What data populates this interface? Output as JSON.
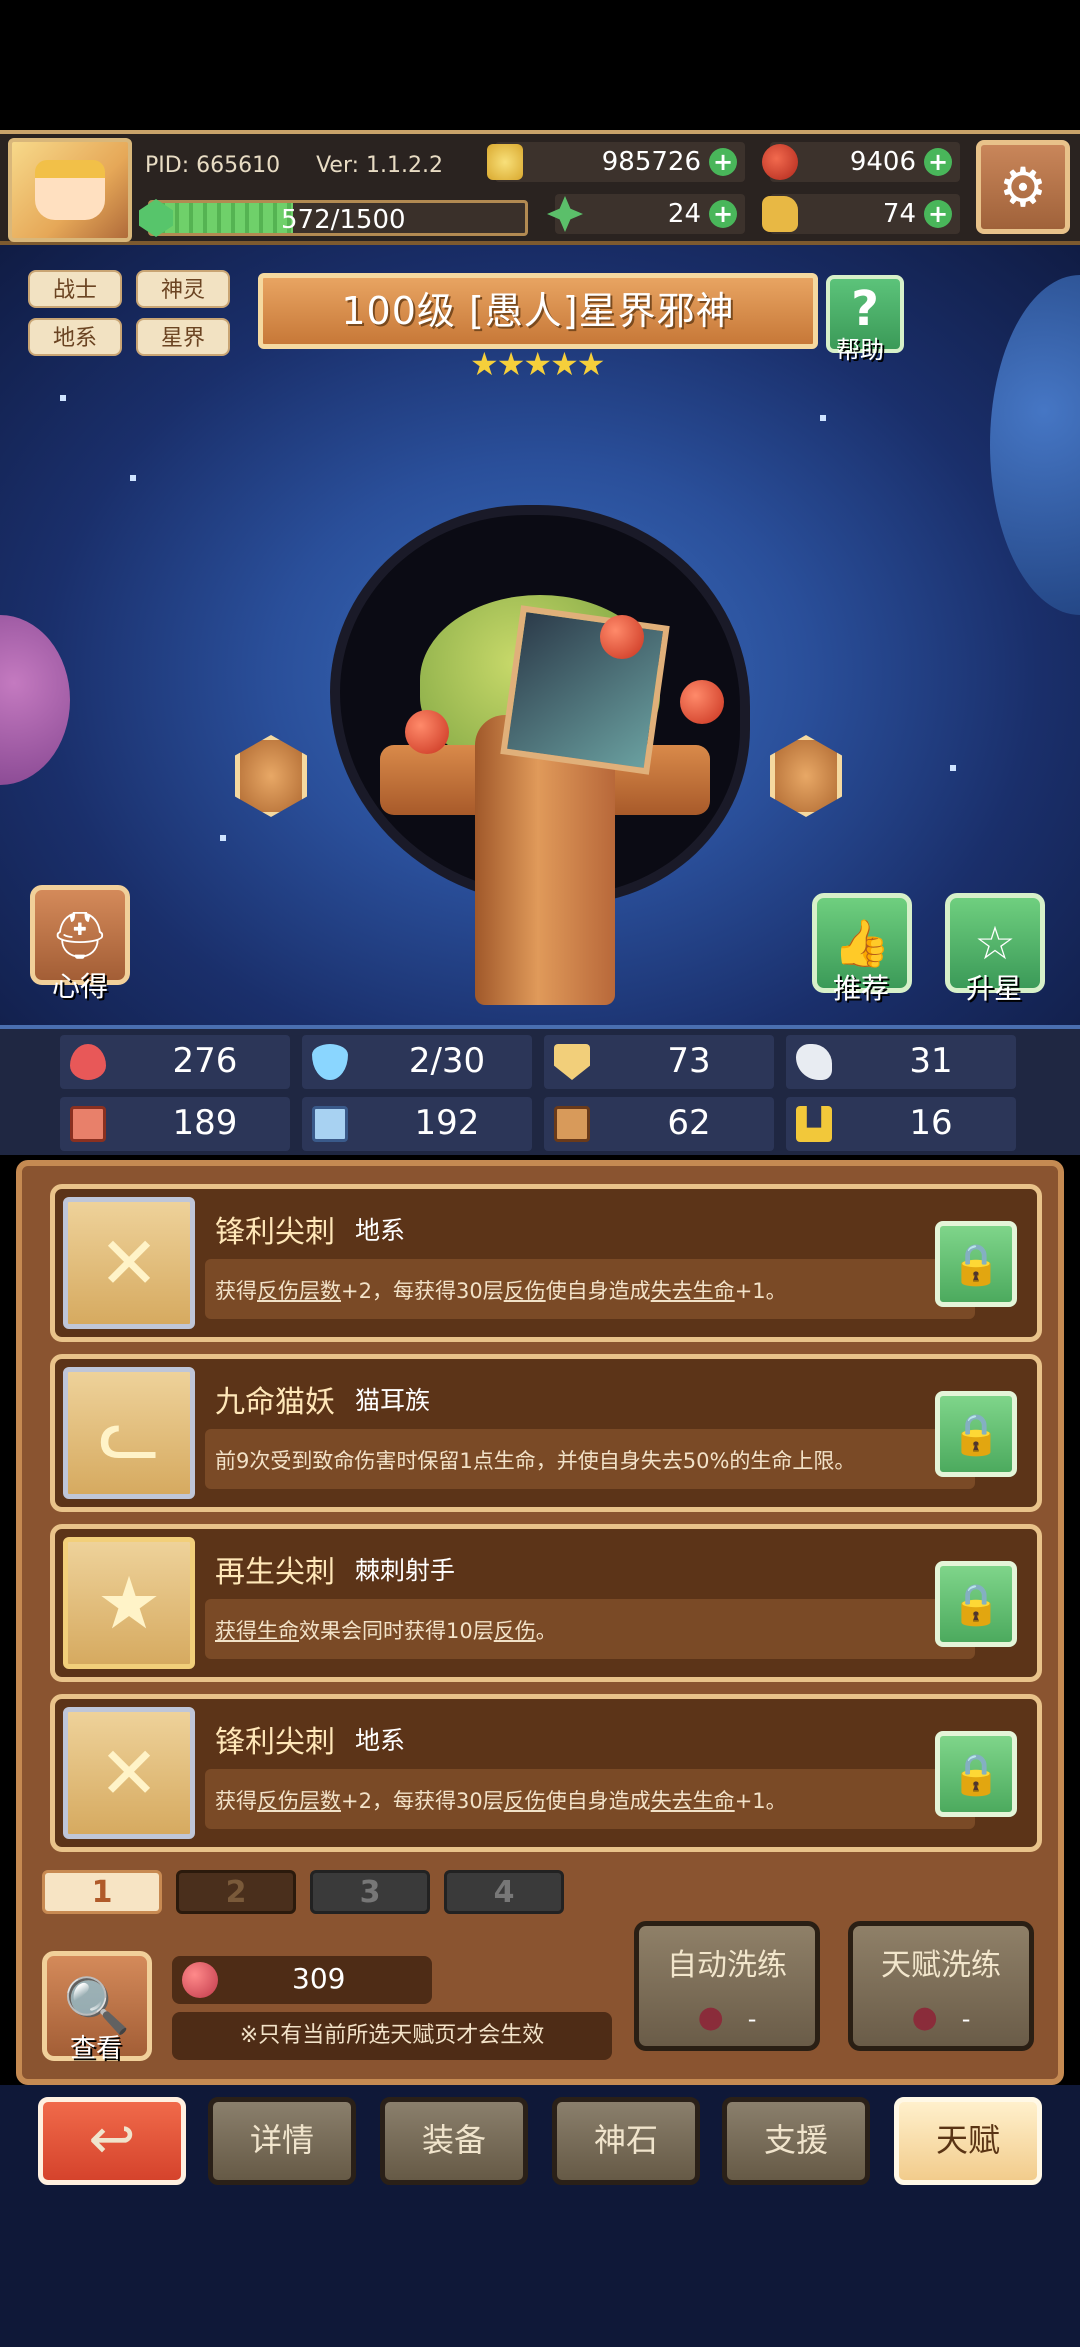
{
  "topbar": {
    "pid": "PID: 665610",
    "version": "Ver: 1.1.2.2",
    "xp": "572/1500",
    "xp_fraction": 0.381,
    "coins": "985726",
    "apples": "9406",
    "clovers": "24",
    "bags": "74"
  },
  "tags": [
    "战士",
    "神灵",
    "地系",
    "星界"
  ],
  "title": "100级 [愚人]星界邪神",
  "stars": "★★★★★",
  "help_label": "帮助",
  "side_buttons": {
    "xinde": "心得",
    "tuijian": "推荐",
    "shengxing": "升星"
  },
  "stats": {
    "hp": "276",
    "mana": "2/30",
    "defense": "73",
    "speed": "31",
    "attack": "189",
    "magic": "192",
    "stairs": "62",
    "horseshoe": "16"
  },
  "talents": [
    {
      "name": "锋利尖刺",
      "kind": "地系",
      "desc_parts": [
        "获得",
        "反伤层数",
        "+2，每获得30层",
        "反伤",
        "使自身造成",
        "失去生命",
        "+1。"
      ]
    },
    {
      "name": "九命猫妖",
      "kind": "猫耳族",
      "desc": "前9次受到致命伤害时保留1点生命，并使自身失去50%的生命上限。"
    },
    {
      "name": "再生尖刺",
      "kind": "棘刺射手",
      "desc_parts": [
        "获得生命",
        "效果会同时获得10层",
        "反伤",
        "。"
      ]
    },
    {
      "name": "锋利尖刺",
      "kind": "地系",
      "desc_parts": [
        "获得",
        "反伤层数",
        "+2，每获得30层",
        "反伤",
        "使自身造成",
        "失去生命",
        "+1。"
      ]
    }
  ],
  "pages": [
    "1",
    "2",
    "3",
    "4"
  ],
  "look_label": "查看",
  "fruit_count": "309",
  "notice": "※只有当前所选天赋页才会生效",
  "auto_refine": {
    "label": "自动洗练",
    "cost": "-"
  },
  "talent_refine": {
    "label": "天赋洗练",
    "cost": "-"
  },
  "nav": {
    "detail": "详情",
    "equip": "装备",
    "godstone": "神石",
    "support": "支援",
    "talent": "天赋"
  },
  "colors": {
    "accent_green": "#49b65a",
    "panel_brown": "#8a5430",
    "back_red": "#e6543a"
  }
}
